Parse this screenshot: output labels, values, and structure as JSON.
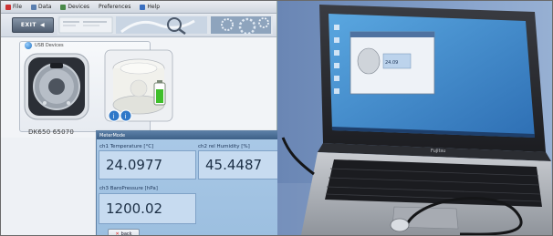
{
  "menu": {
    "items": [
      {
        "label": "File",
        "icon": "file-icon"
      },
      {
        "label": "Data",
        "icon": "data-icon"
      },
      {
        "label": "Devices",
        "icon": "devices-icon"
      },
      {
        "label": "Preferences",
        "icon": ""
      },
      {
        "label": "Help",
        "icon": "help-icon"
      }
    ]
  },
  "toolbar": {
    "exit_label": "EXIT"
  },
  "devices": {
    "usb_label": "USB Devices",
    "device_name": "DK650 65070"
  },
  "metermode": {
    "title": "MeterMode",
    "channels": [
      {
        "label": "ch1 Temperature  [°C]",
        "value": "24.0977"
      },
      {
        "label": "ch2 rel Humidity  [%]",
        "value": "45.4487"
      },
      {
        "label": "ch3 BaroPressure [hPa]",
        "value": "1200.02"
      }
    ],
    "back_label": "back"
  },
  "laptop": {
    "screen_readout": "24.09",
    "brand": "Fujitsu"
  },
  "colors": {
    "accent": "#3d6087",
    "value_box": "#c7dbf0",
    "battery_green": "#3fbf2a"
  }
}
